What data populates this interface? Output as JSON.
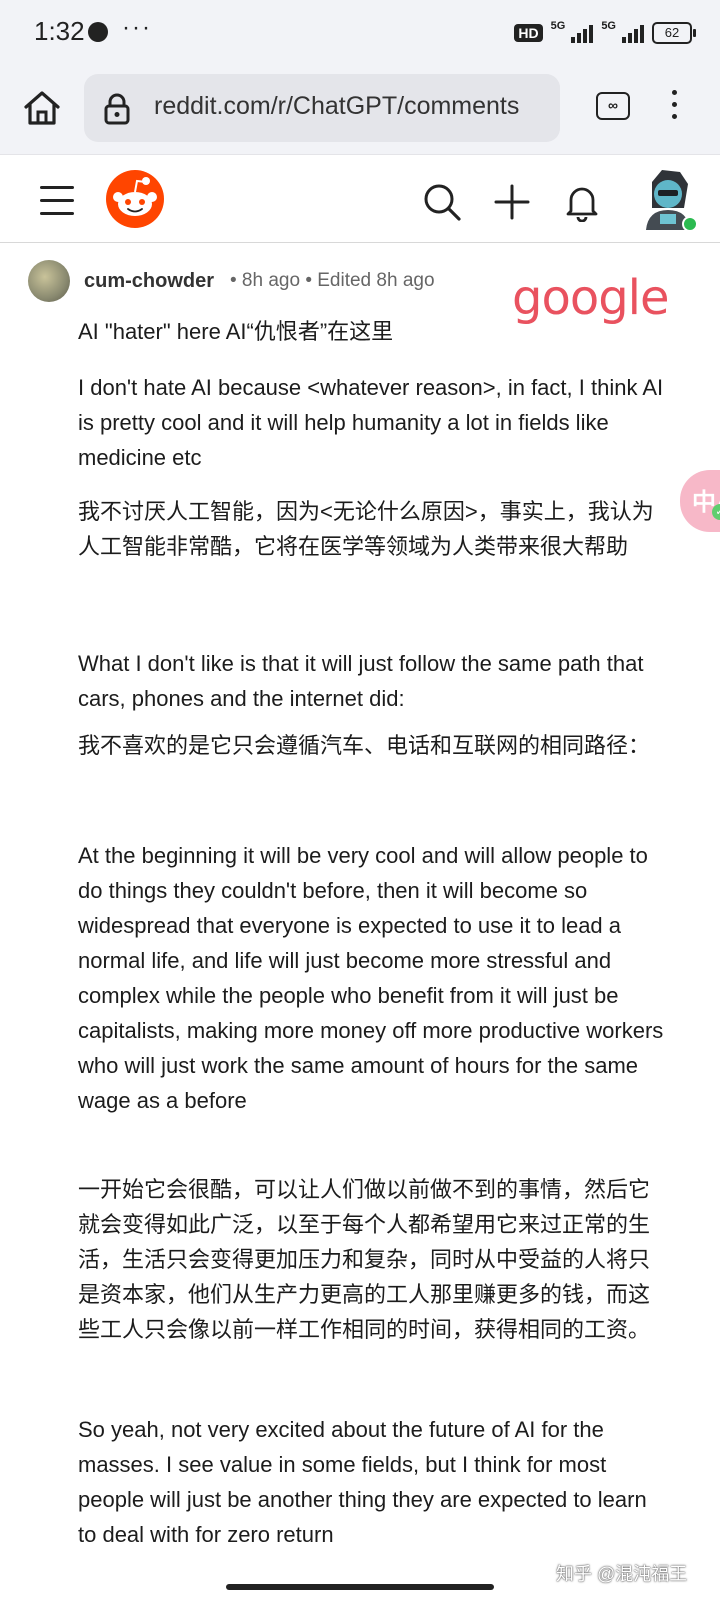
{
  "status_bar": {
    "time": "1:32",
    "more": "···",
    "hd_label": "HD",
    "sig1_label": "5G",
    "sig2_label": "5G",
    "battery": "62"
  },
  "browser": {
    "url": "reddit.com/r/ChatGPT/comments",
    "tabs_label": "∞"
  },
  "comment": {
    "author": "cum-chowder",
    "meta": "• 8h ago • Edited 8h ago",
    "paragraphs": [
      "AI \"hater\" here  AI“仇恨者”在这里",
      "I don't hate AI because <whatever reason>, in fact, I think AI is pretty cool and it will help humanity a lot in fields like medicine etc",
      "我不讨厌人工智能，因为<无论什么原因>，事实上，我认为人工智能非常酷，它将在医学等领域为人类带来很大帮助",
      "What I don't like is that it will just follow the same path that cars, phones and the internet did:",
      "我不喜欢的是它只会遵循汽车、电话和互联网的相同路径：",
      "At the beginning it will be very cool and will allow people to do things they couldn't before, then it will become so widespread that everyone is expected to use it to lead a normal life, and life will just become more stressful and complex while the people who benefit from it will just be capitalists, making more money off more productive workers who will just work the same amount of hours for the same wage as a before",
      "一开始它会很酷，可以让人们做以前做不到的事情，然后它就会变得如此广泛，以至于每个人都希望用它来过正常的生活，生活只会变得更加压力和复杂，同时从中受益的人将只是资本家，他们从生产力更高的工人那里赚更多的钱，而这些工人只会像以前一样工作相同的时间，获得相同的工资。",
      "So yeah, not very excited about the future of AI for the masses. I see value in some fields, but I think for most people will just be another thing they are expected to learn to deal with for zero return"
    ]
  },
  "overlays": {
    "google_watermark": "google",
    "translate_glyph": "中A",
    "zhihu_watermark": "知乎 @混沌福王"
  },
  "colors": {
    "reddit_orange": "#ff4500",
    "google_watermark": "#e9525f",
    "online": "#2bba50"
  },
  "icons": [
    "home-icon",
    "lock-icon",
    "tabs-icon",
    "more-vert-icon",
    "menu-icon",
    "reddit-logo-icon",
    "search-icon",
    "plus-icon",
    "bell-icon",
    "avatar-icon",
    "translate-icon"
  ]
}
